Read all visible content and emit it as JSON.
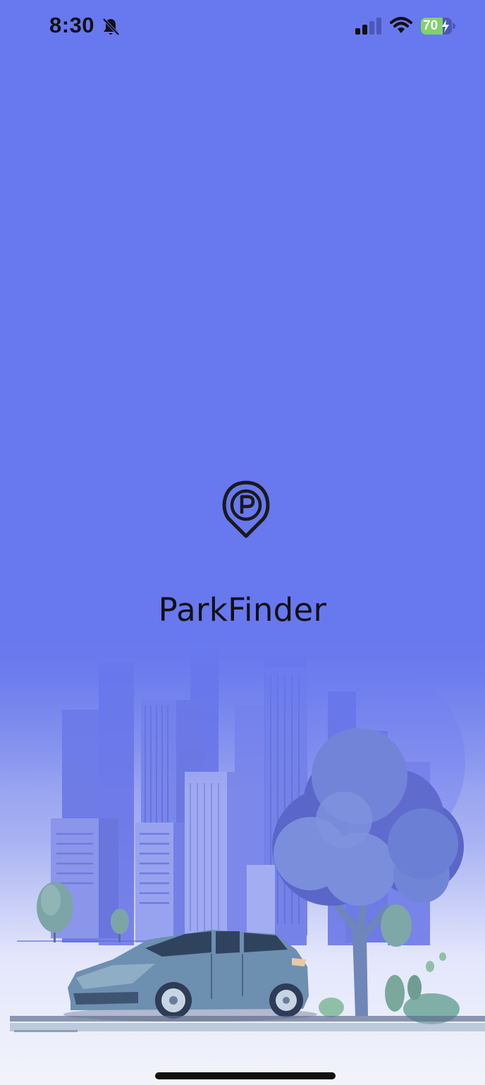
{
  "status_bar": {
    "time": "8:30",
    "battery_percent": "70",
    "battery_level": 0.7,
    "icons": [
      "bell-slash-icon",
      "cellular-signal-icon",
      "wifi-icon",
      "battery-charging-icon"
    ]
  },
  "splash": {
    "app_name": "ParkFinder",
    "logo_icon": "parking-pin-icon",
    "illustration": "city-car-tree-illustration"
  },
  "colors": {
    "background": "#6878ef",
    "text": "#111111",
    "battery_fill": "#7ed36a"
  }
}
